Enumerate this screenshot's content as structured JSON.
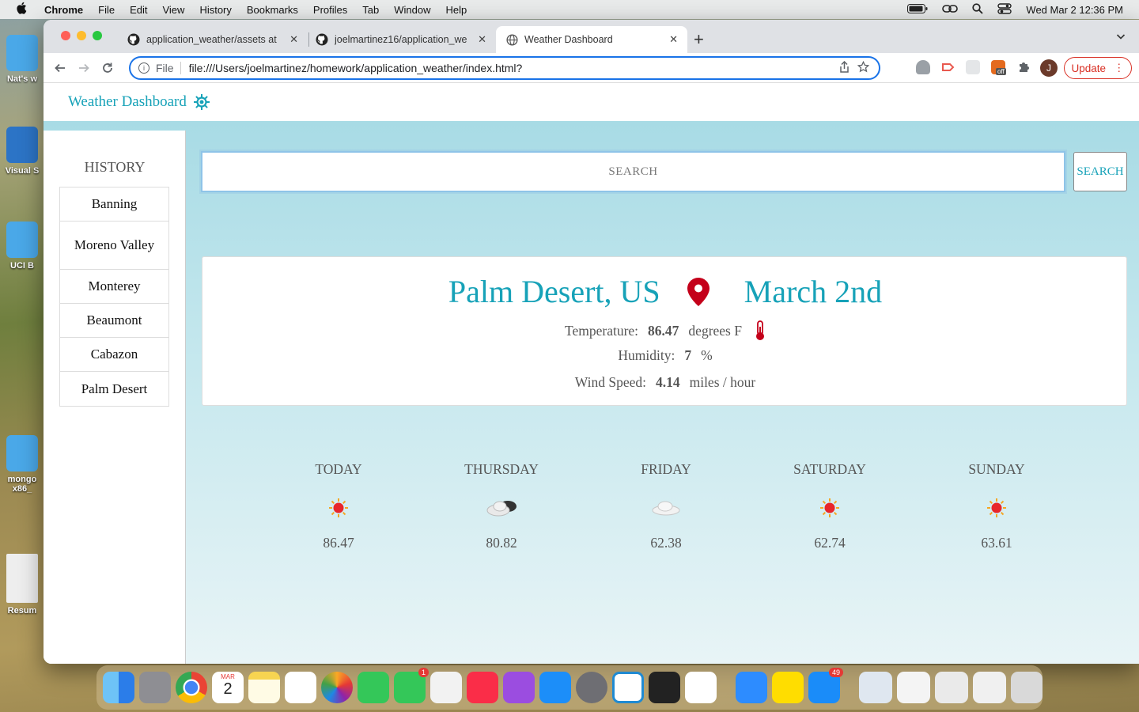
{
  "menubar": {
    "app": "Chrome",
    "items": [
      "File",
      "Edit",
      "View",
      "History",
      "Bookmarks",
      "Profiles",
      "Tab",
      "Window",
      "Help"
    ],
    "clock": "Wed Mar 2  12:36 PM"
  },
  "desktop": {
    "items": [
      "Nat's w",
      "Visual S",
      "UCI B",
      "mongo x86_",
      "Resum"
    ]
  },
  "browser": {
    "tabs": [
      {
        "label": "application_weather/assets at",
        "icon": "github-icon"
      },
      {
        "label": "joelmartinez16/application_we",
        "icon": "github-icon"
      },
      {
        "label": "Weather Dashboard",
        "icon": "globe-icon",
        "active": true
      }
    ],
    "new_tab": "+",
    "url_scheme": "File",
    "url": "file:///Users/joelmartinez/homework/application_weather/index.html?",
    "profile_initial": "J",
    "update_label": "Update",
    "ext_badge": "off"
  },
  "page": {
    "brand": "Weather Dashboard",
    "history_title": "HISTORY",
    "history": [
      "Banning",
      "Moreno Valley",
      "Monterey",
      "Beaumont",
      "Cabazon",
      "Palm Desert"
    ],
    "search_placeholder": "SEARCH",
    "search_button": "SEARCH",
    "current": {
      "city": "Palm Desert, US",
      "date": "March 2nd",
      "temp_label": "Temperature:",
      "temp_value": "86.47",
      "temp_unit": "degrees F",
      "humidity_label": "Humidity:",
      "humidity_value": "7",
      "humidity_unit": "%",
      "wind_label": "Wind Speed:",
      "wind_value": "4.14",
      "wind_unit": "miles / hour"
    },
    "forecast": [
      {
        "day": "TODAY",
        "icon": "sun-icon",
        "temp": "86.47"
      },
      {
        "day": "THURSDAY",
        "icon": "cloud-sun-icon",
        "temp": "80.82"
      },
      {
        "day": "FRIDAY",
        "icon": "cloud-icon",
        "temp": "62.38"
      },
      {
        "day": "SATURDAY",
        "icon": "sun-icon",
        "temp": "62.74"
      },
      {
        "day": "SUNDAY",
        "icon": "sun-icon",
        "temp": "63.61"
      }
    ]
  },
  "dock": {
    "calendar_month": "MAR",
    "calendar_day": "2",
    "messages_badge": "1",
    "mail_badge": "49"
  },
  "colors": {
    "accent": "#17a2b8",
    "pin": "#c4001a",
    "sun": "#e8262a"
  }
}
